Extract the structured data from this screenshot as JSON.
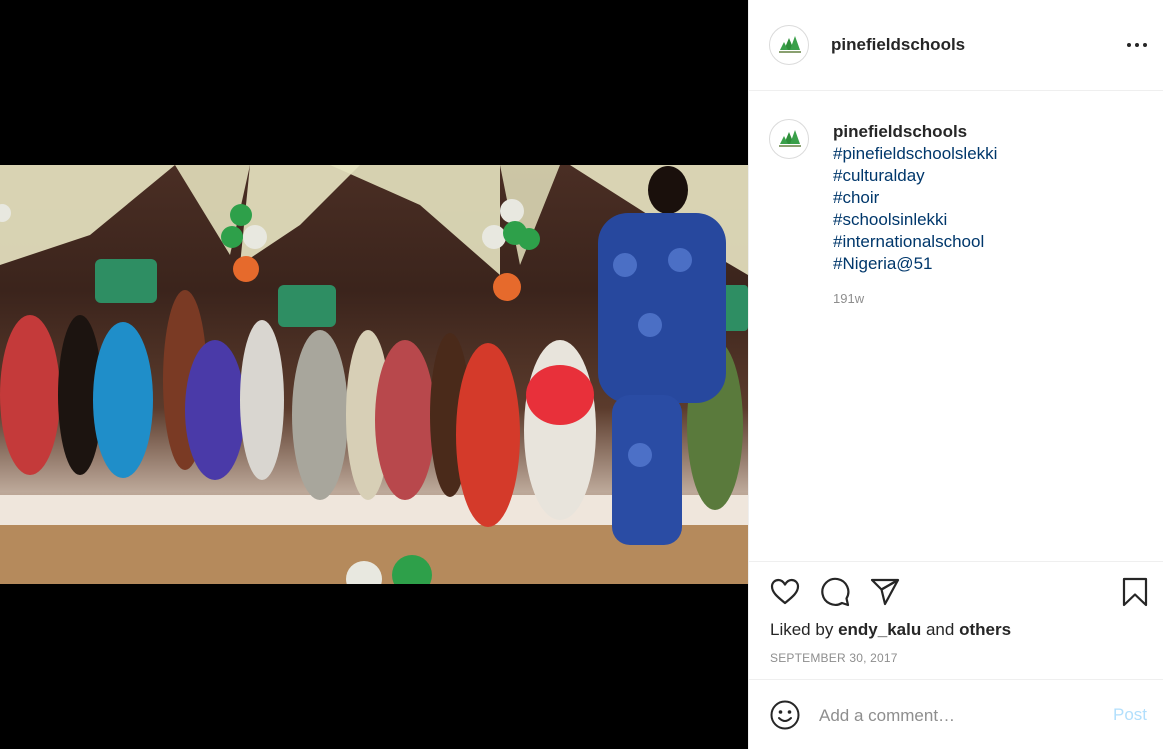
{
  "post": {
    "username": "pinefieldschools",
    "caption_username": "pinefieldschools",
    "hashtags": [
      "#pinefieldschoolslekki",
      "#culturalday",
      "#choir",
      "#schoolsinlekki",
      "#internationalschool",
      "#Nigeria@51"
    ],
    "time_ago": "191w",
    "likes_prefix": "Liked by",
    "liked_by_user": "endy_kalu",
    "likes_and": "and",
    "likes_others": "others",
    "date": "SEPTEMBER 30, 2017"
  },
  "comment": {
    "placeholder": "Add a comment…",
    "post_label": "Post"
  },
  "colors": {
    "hashtag": "#00376b",
    "post_button_disabled": "#b2dffc",
    "muted": "#8e8e8e"
  },
  "icons": {
    "more": "more-horizontal-icon",
    "like": "heart-icon",
    "comment": "comment-bubble-icon",
    "share": "paper-plane-icon",
    "save": "bookmark-icon",
    "emoji": "smiley-icon"
  }
}
